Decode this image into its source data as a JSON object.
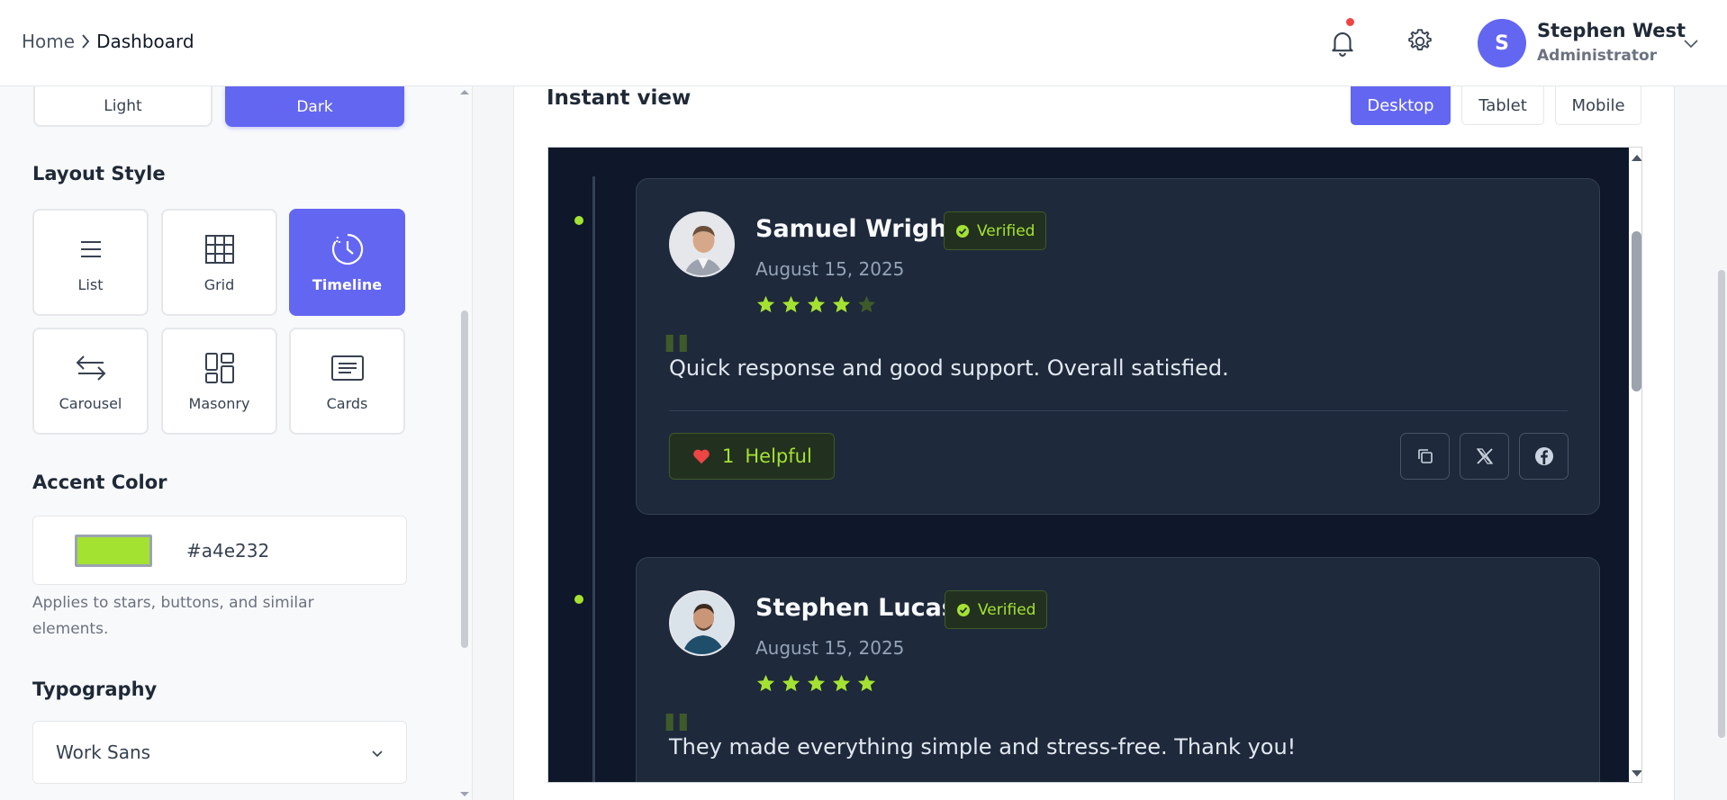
{
  "header": {
    "breadcrumb_home": "Home",
    "breadcrumb_sep": ">",
    "breadcrumb_current": "Dashboard",
    "user": {
      "initial": "S",
      "name": "Stephen West",
      "role": "Administrator"
    }
  },
  "left": {
    "theme": {
      "light": "Light",
      "dark": "Dark",
      "selected": "Dark"
    },
    "layout_title": "Layout Style",
    "layouts": [
      {
        "label": "List",
        "icon": "list-icon"
      },
      {
        "label": "Grid",
        "icon": "grid-icon"
      },
      {
        "label": "Timeline",
        "icon": "clock-icon",
        "active": true
      },
      {
        "label": "Carousel",
        "icon": "arrows-swap-icon"
      },
      {
        "label": "Masonry",
        "icon": "masonry-icon"
      },
      {
        "label": "Cards",
        "icon": "card-icon"
      }
    ],
    "accent_title": "Accent Color",
    "accent_value": "#a4e232",
    "accent_help": "Applies to stars, buttons, and similar elements.",
    "typography_title": "Typography",
    "font_value": "Work Sans"
  },
  "preview": {
    "title": "Instant view",
    "views": {
      "desktop": "Desktop",
      "tablet": "Tablet",
      "mobile": "Mobile",
      "selected": "Desktop"
    },
    "reviews": [
      {
        "name": "Samuel Wright",
        "verified": "Verified",
        "date": "August 15, 2025",
        "rating": 4,
        "text": "Quick response and good support. Overall satisfied.",
        "helpful_count": "1",
        "helpful_label": "Helpful"
      },
      {
        "name": "Stephen Lucas",
        "verified": "Verified",
        "date": "August 15, 2025",
        "rating": 5,
        "text": "They made everything simple and stress-free. Thank you!"
      }
    ]
  },
  "colors": {
    "accent": "#a4e232",
    "primary": "#6366f1",
    "frame_bg": "#0f172a",
    "card_bg": "#1e293b"
  }
}
